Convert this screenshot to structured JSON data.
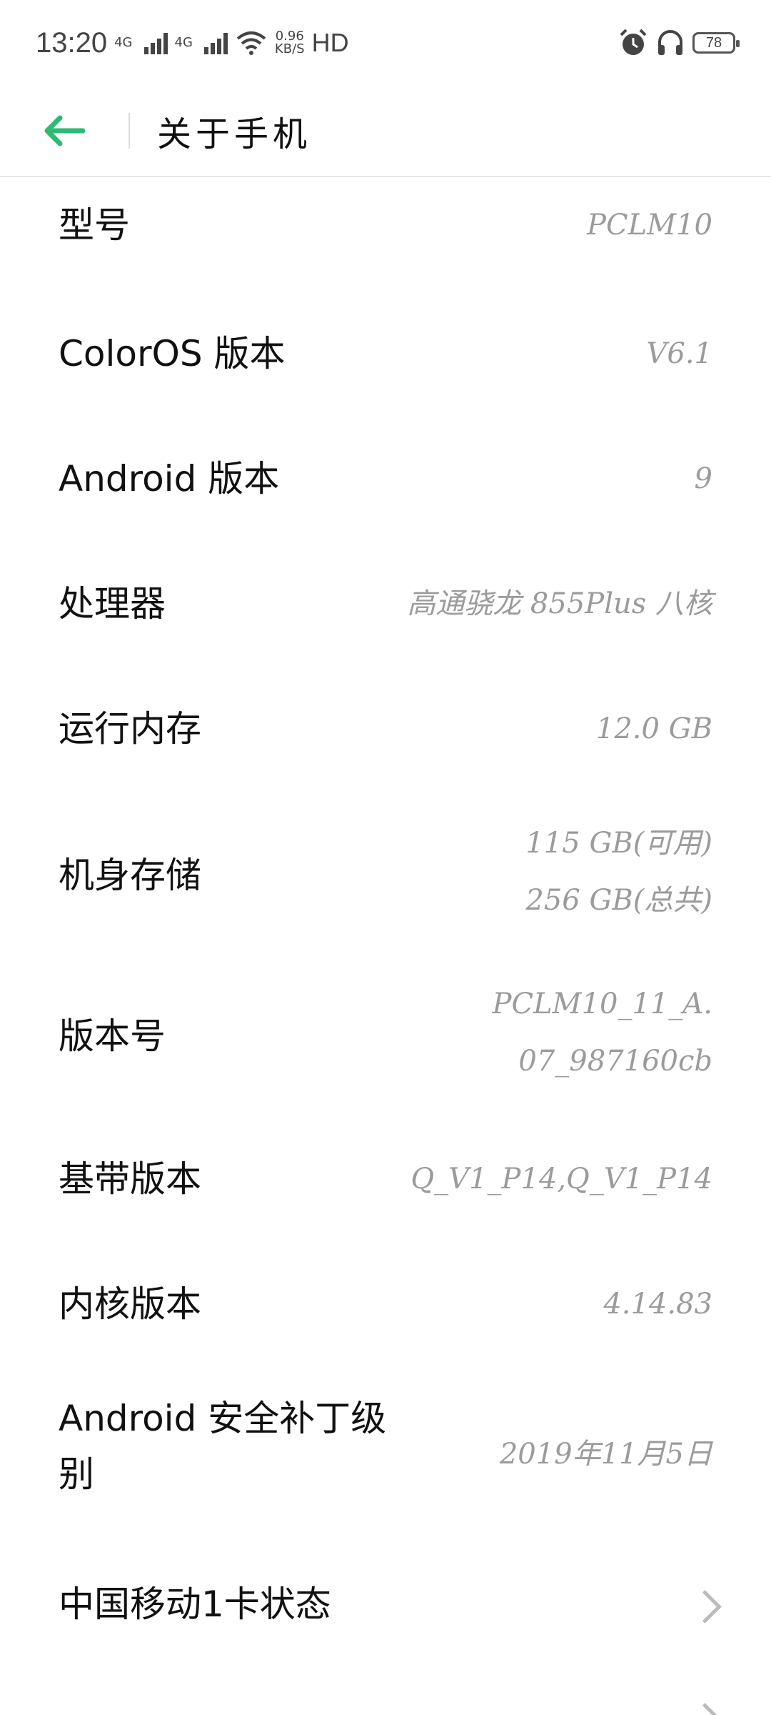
{
  "status_bar": {
    "time": "13:20",
    "sim1": "4G",
    "sim2": "4G",
    "speed_value": "0.96",
    "speed_unit": "KB/S",
    "hd": "HD",
    "battery": "78"
  },
  "header": {
    "title": "关于手机"
  },
  "rows": [
    {
      "label": "型号",
      "value": "PCLM10"
    },
    {
      "label": "ColorOS 版本",
      "value": "V6.1"
    },
    {
      "label": "Android 版本",
      "value": "9"
    },
    {
      "label": "处理器",
      "value": "高通骁龙 855Plus 八核"
    },
    {
      "label": "运行内存",
      "value": "12.0 GB"
    },
    {
      "label": "机身存储",
      "value_line1": "115 GB(可用)",
      "value_line2": "256 GB(总共)"
    },
    {
      "label": "版本号",
      "value_line1": "PCLM10_11_A.",
      "value_line2": "07_987160cb"
    },
    {
      "label": "基带版本",
      "value": "Q_V1_P14,Q_V1_P14"
    },
    {
      "label": "内核版本",
      "value": "4.14.83"
    },
    {
      "label_line1": "Android 安全补丁级",
      "label_line2": "别",
      "value": "2019年11月5日"
    },
    {
      "label": "中国移动1卡状态"
    }
  ],
  "colors": {
    "accent": "#2dbb73",
    "value_gray": "#9b9b9b"
  }
}
